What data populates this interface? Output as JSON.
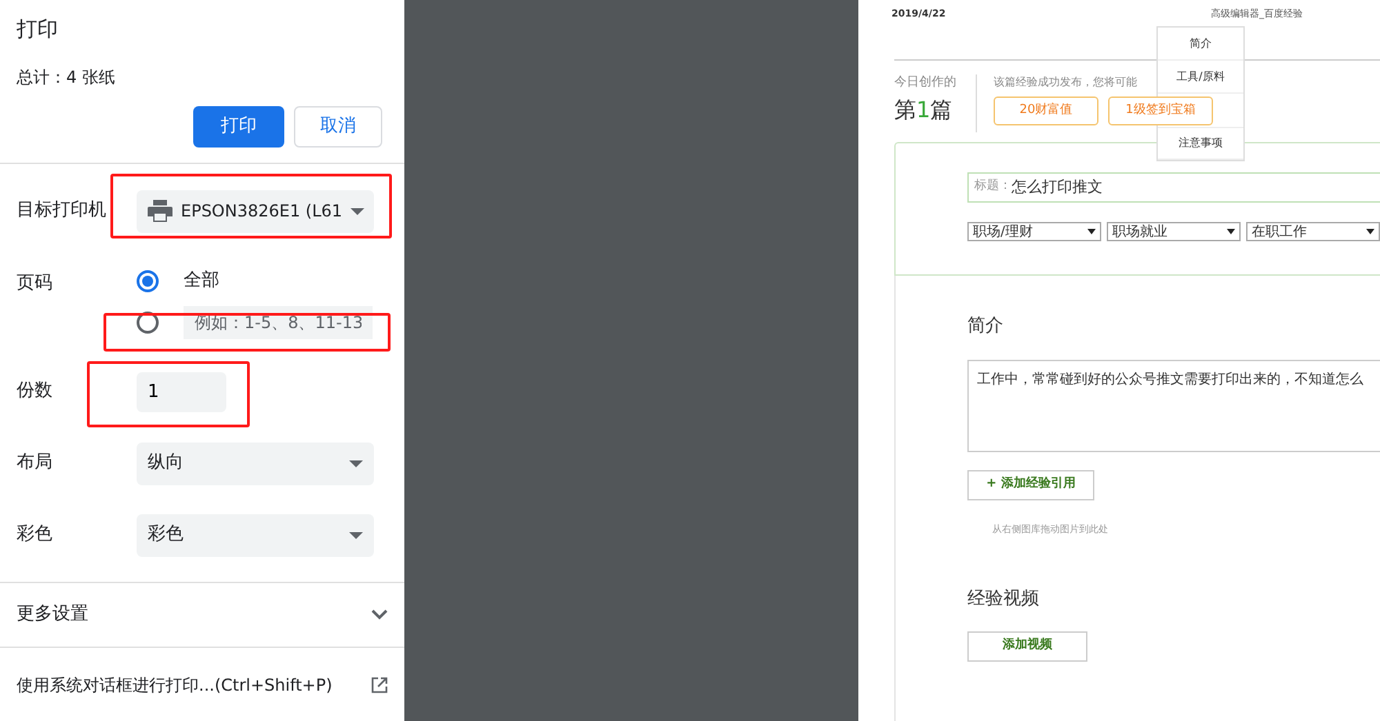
{
  "dialog": {
    "title": "打印",
    "summary": "总计：4 张纸",
    "buttons": [
      {
        "label": "打印",
        "kind": "primary"
      },
      {
        "label": "取消",
        "kind": "secondary"
      }
    ],
    "destination": {
      "label": "目标打印机",
      "value": "EPSON3826E1 (L61"
    },
    "pages": {
      "label": "页码",
      "options": [
        {
          "label": "全部",
          "kind": "option",
          "selected": true
        },
        {
          "placeholder": "例如：1-5、8、11-13",
          "kind": "range",
          "selected": false
        }
      ]
    },
    "copies": {
      "label": "份数",
      "value": "1"
    },
    "layout": {
      "label": "布局",
      "value": "纵向"
    },
    "color": {
      "label": "彩色",
      "value": "彩色"
    },
    "more_settings": {
      "label": "更多设置",
      "expanded": false
    },
    "system_dialog": "使用系统对话框进行打印...(Ctrl+Shift+P)"
  },
  "preview": {
    "date": "2019/4/22",
    "page_title": "高级编辑器_百度经验",
    "menu": [
      {
        "label": "简介"
      },
      {
        "label": "工具/原料"
      },
      {
        "label": "注意事项"
      }
    ],
    "today_label": "今日创作的",
    "count": {
      "before": "第",
      "number": "1",
      "after": "篇"
    },
    "publish_note": "该篇经验成功发布，您将可能",
    "rewards": [
      "20财富值",
      "1级签到宝箱"
    ],
    "title_label": "标题：",
    "title_value": "怎么打印推文",
    "categories": [
      "职场/理财",
      "职场就业",
      "在职工作"
    ],
    "intro_heading": "简介",
    "intro_text": "工作中，常常碰到好的公众号推文需要打印出来的，不知道怎么",
    "add_reference": "+ 添加经验引用",
    "drop_hint": "从右侧图库拖动图片到此处",
    "video_heading": "经验视频",
    "add_video": "添加视频"
  }
}
